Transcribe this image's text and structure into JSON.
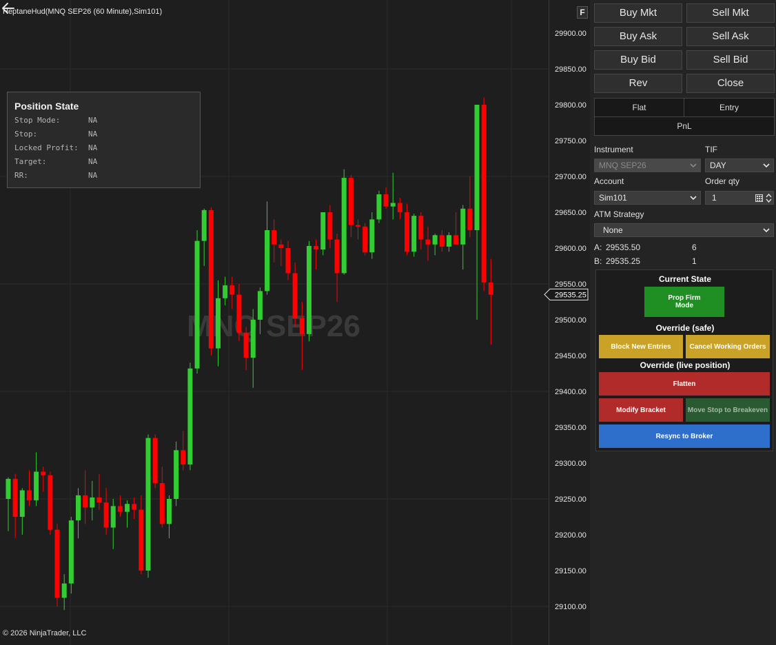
{
  "chart": {
    "title": "HeptaneHud(MNQ SEP26 (60 Minute),Sim101)",
    "watermark": "MNQ SEP26",
    "copyright": "© 2026 NinjaTrader, LLC",
    "price_labels": [
      "29900.00",
      "29850.00",
      "29800.00",
      "29750.00",
      "29700.00",
      "29650.00",
      "29600.00",
      "29550.00",
      "29500.00",
      "29450.00",
      "29400.00",
      "29350.00",
      "29300.00",
      "29250.00",
      "29200.00",
      "29150.00",
      "29100.00"
    ],
    "current_price": "29535.25",
    "f_button": "F",
    "up_color": "#32cd32",
    "down_color": "#ff0000"
  },
  "chart_data": {
    "type": "candlestick",
    "ylim": [
      29060,
      29930
    ],
    "candles": [
      {
        "o": 29250,
        "h": 29280,
        "l": 29205,
        "c": 29278
      },
      {
        "o": 29278,
        "h": 29285,
        "l": 29195,
        "c": 29225
      },
      {
        "o": 29225,
        "h": 29265,
        "l": 29200,
        "c": 29262
      },
      {
        "o": 29262,
        "h": 29290,
        "l": 29240,
        "c": 29248
      },
      {
        "o": 29248,
        "h": 29315,
        "l": 29240,
        "c": 29288
      },
      {
        "o": 29288,
        "h": 29295,
        "l": 29260,
        "c": 29283
      },
      {
        "o": 29283,
        "h": 29288,
        "l": 29200,
        "c": 29207
      },
      {
        "o": 29207,
        "h": 29215,
        "l": 29100,
        "c": 29112
      },
      {
        "o": 29112,
        "h": 29145,
        "l": 29095,
        "c": 29132
      },
      {
        "o": 29132,
        "h": 29225,
        "l": 29118,
        "c": 29220
      },
      {
        "o": 29220,
        "h": 29265,
        "l": 29195,
        "c": 29255
      },
      {
        "o": 29255,
        "h": 29290,
        "l": 29215,
        "c": 29238
      },
      {
        "o": 29238,
        "h": 29275,
        "l": 29220,
        "c": 29252
      },
      {
        "o": 29252,
        "h": 29285,
        "l": 29235,
        "c": 29245
      },
      {
        "o": 29245,
        "h": 29265,
        "l": 29200,
        "c": 29210
      },
      {
        "o": 29210,
        "h": 29250,
        "l": 29180,
        "c": 29240
      },
      {
        "o": 29240,
        "h": 29255,
        "l": 29225,
        "c": 29232
      },
      {
        "o": 29232,
        "h": 29248,
        "l": 29210,
        "c": 29243
      },
      {
        "o": 29243,
        "h": 29252,
        "l": 29222,
        "c": 29235
      },
      {
        "o": 29235,
        "h": 29255,
        "l": 29145,
        "c": 29150
      },
      {
        "o": 29150,
        "h": 29340,
        "l": 29140,
        "c": 29335
      },
      {
        "o": 29335,
        "h": 29340,
        "l": 29265,
        "c": 29272
      },
      {
        "o": 29272,
        "h": 29295,
        "l": 29210,
        "c": 29215
      },
      {
        "o": 29215,
        "h": 29255,
        "l": 29195,
        "c": 29250
      },
      {
        "o": 29250,
        "h": 29330,
        "l": 29240,
        "c": 29318
      },
      {
        "o": 29318,
        "h": 29345,
        "l": 29290,
        "c": 29298
      },
      {
        "o": 29298,
        "h": 29440,
        "l": 29290,
        "c": 29432
      },
      {
        "o": 29432,
        "h": 29625,
        "l": 29425,
        "c": 29610
      },
      {
        "o": 29610,
        "h": 29655,
        "l": 29575,
        "c": 29653
      },
      {
        "o": 29653,
        "h": 29657,
        "l": 29450,
        "c": 29460
      },
      {
        "o": 29460,
        "h": 29555,
        "l": 29435,
        "c": 29530
      },
      {
        "o": 29530,
        "h": 29560,
        "l": 29520,
        "c": 29548
      },
      {
        "o": 29548,
        "h": 29560,
        "l": 29515,
        "c": 29535
      },
      {
        "o": 29535,
        "h": 29550,
        "l": 29470,
        "c": 29482
      },
      {
        "o": 29482,
        "h": 29490,
        "l": 29430,
        "c": 29447
      },
      {
        "o": 29447,
        "h": 29515,
        "l": 29405,
        "c": 29500
      },
      {
        "o": 29500,
        "h": 29545,
        "l": 29480,
        "c": 29540
      },
      {
        "o": 29540,
        "h": 29665,
        "l": 29535,
        "c": 29625
      },
      {
        "o": 29625,
        "h": 29640,
        "l": 29580,
        "c": 29605
      },
      {
        "o": 29605,
        "h": 29612,
        "l": 29575,
        "c": 29600
      },
      {
        "o": 29600,
        "h": 29610,
        "l": 29555,
        "c": 29565
      },
      {
        "o": 29565,
        "h": 29580,
        "l": 29490,
        "c": 29502
      },
      {
        "o": 29502,
        "h": 29525,
        "l": 29430,
        "c": 29480
      },
      {
        "o": 29480,
        "h": 29610,
        "l": 29470,
        "c": 29603
      },
      {
        "o": 29603,
        "h": 29612,
        "l": 29570,
        "c": 29598
      },
      {
        "o": 29598,
        "h": 29650,
        "l": 29590,
        "c": 29650
      },
      {
        "o": 29650,
        "h": 29660,
        "l": 29600,
        "c": 29612
      },
      {
        "o": 29612,
        "h": 29620,
        "l": 29525,
        "c": 29565
      },
      {
        "o": 29565,
        "h": 29710,
        "l": 29563,
        "c": 29698
      },
      {
        "o": 29698,
        "h": 29702,
        "l": 29615,
        "c": 29632
      },
      {
        "o": 29632,
        "h": 29640,
        "l": 29612,
        "c": 29630
      },
      {
        "o": 29630,
        "h": 29635,
        "l": 29590,
        "c": 29594
      },
      {
        "o": 29594,
        "h": 29650,
        "l": 29585,
        "c": 29640
      },
      {
        "o": 29640,
        "h": 29680,
        "l": 29635,
        "c": 29675
      },
      {
        "o": 29675,
        "h": 29685,
        "l": 29655,
        "c": 29658
      },
      {
        "o": 29658,
        "h": 29705,
        "l": 29640,
        "c": 29663
      },
      {
        "o": 29663,
        "h": 29670,
        "l": 29640,
        "c": 29650
      },
      {
        "o": 29650,
        "h": 29662,
        "l": 29590,
        "c": 29595
      },
      {
        "o": 29595,
        "h": 29648,
        "l": 29588,
        "c": 29645
      },
      {
        "o": 29645,
        "h": 29650,
        "l": 29598,
        "c": 29612
      },
      {
        "o": 29612,
        "h": 29630,
        "l": 29582,
        "c": 29605
      },
      {
        "o": 29605,
        "h": 29620,
        "l": 29590,
        "c": 29618
      },
      {
        "o": 29618,
        "h": 29625,
        "l": 29595,
        "c": 29602
      },
      {
        "o": 29602,
        "h": 29622,
        "l": 29595,
        "c": 29618
      },
      {
        "o": 29618,
        "h": 29650,
        "l": 29605,
        "c": 29605
      },
      {
        "o": 29605,
        "h": 29660,
        "l": 29570,
        "c": 29655
      },
      {
        "o": 29655,
        "h": 29700,
        "l": 29615,
        "c": 29625
      },
      {
        "o": 29625,
        "h": 29800,
        "l": 29500,
        "c": 29800
      },
      {
        "o": 29800,
        "h": 29810,
        "l": 29540,
        "c": 29552
      },
      {
        "o": 29552,
        "h": 29585,
        "l": 29465,
        "c": 29535
      }
    ]
  },
  "position_state": {
    "title": "Position State",
    "rows": [
      {
        "key": "Stop Mode:",
        "value": "NA"
      },
      {
        "key": "Stop:",
        "value": "NA"
      },
      {
        "key": "Locked Profit:",
        "value": "NA"
      },
      {
        "key": "Target:",
        "value": "NA"
      },
      {
        "key": "RR:",
        "value": "NA"
      }
    ]
  },
  "order_buttons": {
    "buy_mkt": "Buy Mkt",
    "sell_mkt": "Sell Mkt",
    "buy_ask": "Buy Ask",
    "sell_ask": "Sell Ask",
    "buy_bid": "Buy Bid",
    "sell_bid": "Sell Bid",
    "rev": "Rev",
    "close": "Close"
  },
  "status_tabs": {
    "flat": "Flat",
    "entry": "Entry",
    "pnl": "PnL"
  },
  "form": {
    "instrument_label": "Instrument",
    "instrument_value": "MNQ SEP26",
    "tif_label": "TIF",
    "tif_value": "DAY",
    "account_label": "Account",
    "account_value": "Sim101",
    "qty_label": "Order qty",
    "qty_value": "1",
    "atm_label": "ATM Strategy",
    "atm_value": "None"
  },
  "quotes": {
    "ask_label": "A:",
    "ask_price": "29535.50",
    "ask_size": "6",
    "bid_label": "B:",
    "bid_price": "29535.25",
    "bid_size": "1"
  },
  "control": {
    "current_state_heading": "Current State",
    "state_button": "Prop Firm Mode",
    "override_safe_heading": "Override (safe)",
    "block_new_entries": "Block New Entries",
    "cancel_working_orders": "Cancel Working Orders",
    "override_live_heading": "Override (live position)",
    "flatten": "Flatten",
    "modify_bracket": "Modify Bracket",
    "move_stop_breakeven": "Move Stop to Breakeven",
    "resync": "Resync to Broker",
    "colors": {
      "green": "#1f8f23",
      "yellow": "#c9a227",
      "red": "#b22b2b",
      "dark_green": "#2a5a32",
      "blue": "#2f6fcc"
    }
  }
}
